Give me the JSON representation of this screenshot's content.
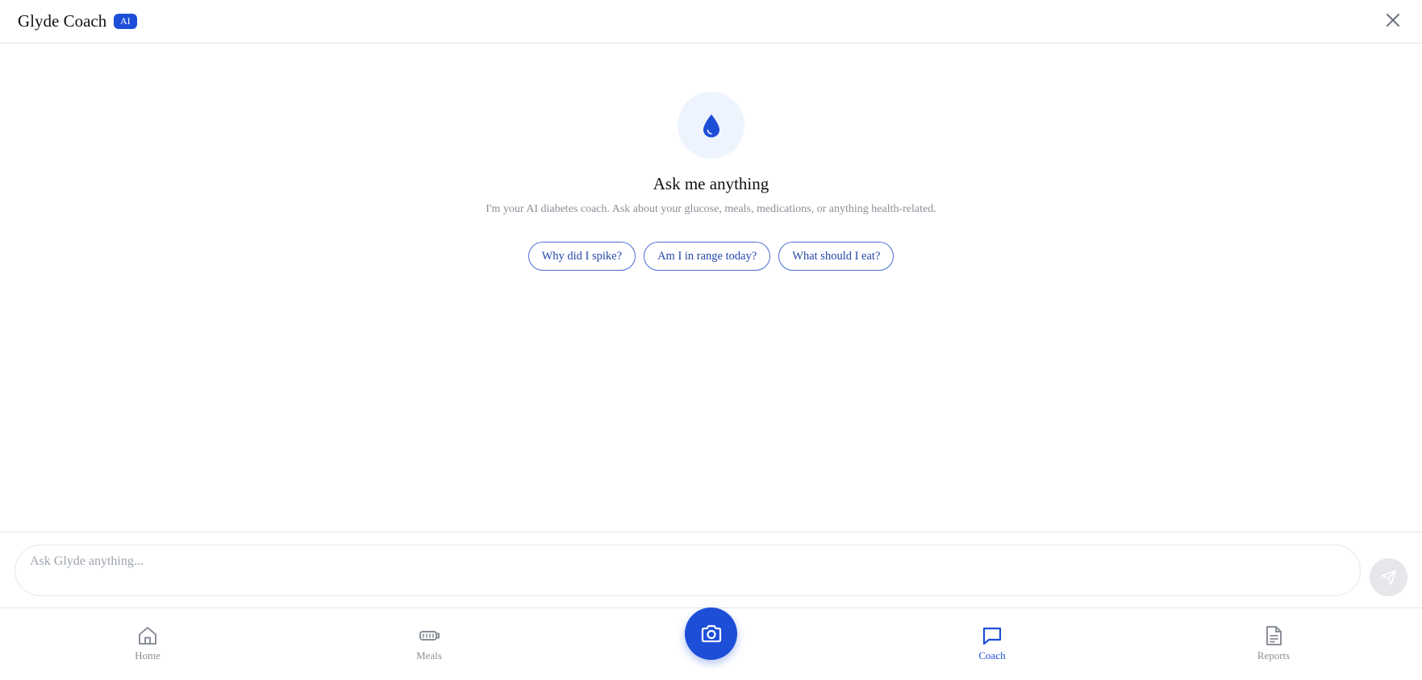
{
  "header": {
    "title": "Glyde Coach",
    "badge": "AI",
    "close_icon": "close-icon"
  },
  "empty_state": {
    "icon": "droplet-icon",
    "title": "Ask me anything",
    "subtitle": "I'm your AI diabetes coach. Ask about your glucose, meals, medications, or anything health-related.",
    "suggestions": [
      "Why did I spike?",
      "Am I in range today?",
      "What should I eat?"
    ]
  },
  "composer": {
    "placeholder": "Ask Glyde anything...",
    "value": "",
    "send_icon": "send-icon"
  },
  "nav": {
    "items": [
      {
        "label": "Home",
        "icon": "home-icon",
        "active": false
      },
      {
        "label": "Meals",
        "icon": "meals-icon",
        "active": false
      },
      {
        "label": "Coach",
        "icon": "chat-icon",
        "active": true
      },
      {
        "label": "Reports",
        "icon": "document-icon",
        "active": false
      }
    ],
    "camera_icon": "camera-icon"
  },
  "colors": {
    "accent": "#1d4ed8",
    "muted_text": "#8a8f98",
    "hero_bg": "#eef4fe",
    "border": "#e5e7eb"
  }
}
